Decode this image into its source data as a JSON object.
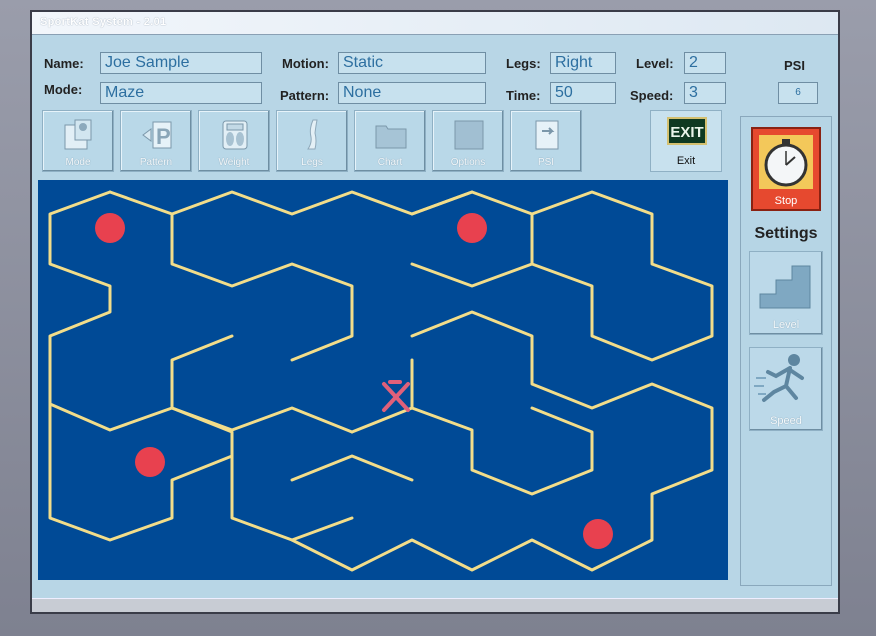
{
  "window": {
    "title": "SportKat System - 2.01"
  },
  "fields": {
    "name_label": "Name:",
    "name_value": "Joe Sample",
    "mode_label": "Mode:",
    "mode_value": "Maze",
    "motion_label": "Motion:",
    "motion_value": "Static",
    "pattern_label": "Pattern:",
    "pattern_value": "None",
    "legs_label": "Legs:",
    "legs_value": "Right",
    "time_label": "Time:",
    "time_value": "50",
    "level_label": "Level:",
    "level_value": "2",
    "speed_label": "Speed:",
    "speed_value": "3",
    "psi_label": "PSI",
    "psi_value": "6"
  },
  "toolbar": {
    "mode": "Mode",
    "pattern": "Pattern",
    "weight": "Weight",
    "legs": "Legs",
    "chart": "Chart",
    "options": "Options",
    "psi": "PSI",
    "exit_sign": "EXIT",
    "exit": "Exit"
  },
  "side": {
    "stop": "Stop",
    "settings": "Settings",
    "level": "Level",
    "speed": "Speed"
  },
  "icons": {
    "mode": "mode-icon",
    "pattern": "pattern-icon",
    "weight": "weight-icon",
    "legs": "legs-icon",
    "chart": "chart-folder-icon",
    "options": "options-icon",
    "psi": "psi-icon",
    "stop": "stopwatch-icon",
    "level": "stairs-icon",
    "speed": "runner-icon"
  },
  "colors": {
    "maze_bg": "#004a96",
    "maze_wall": "#f2dd8a",
    "target": "#e8414f",
    "player": "#e0607a"
  }
}
